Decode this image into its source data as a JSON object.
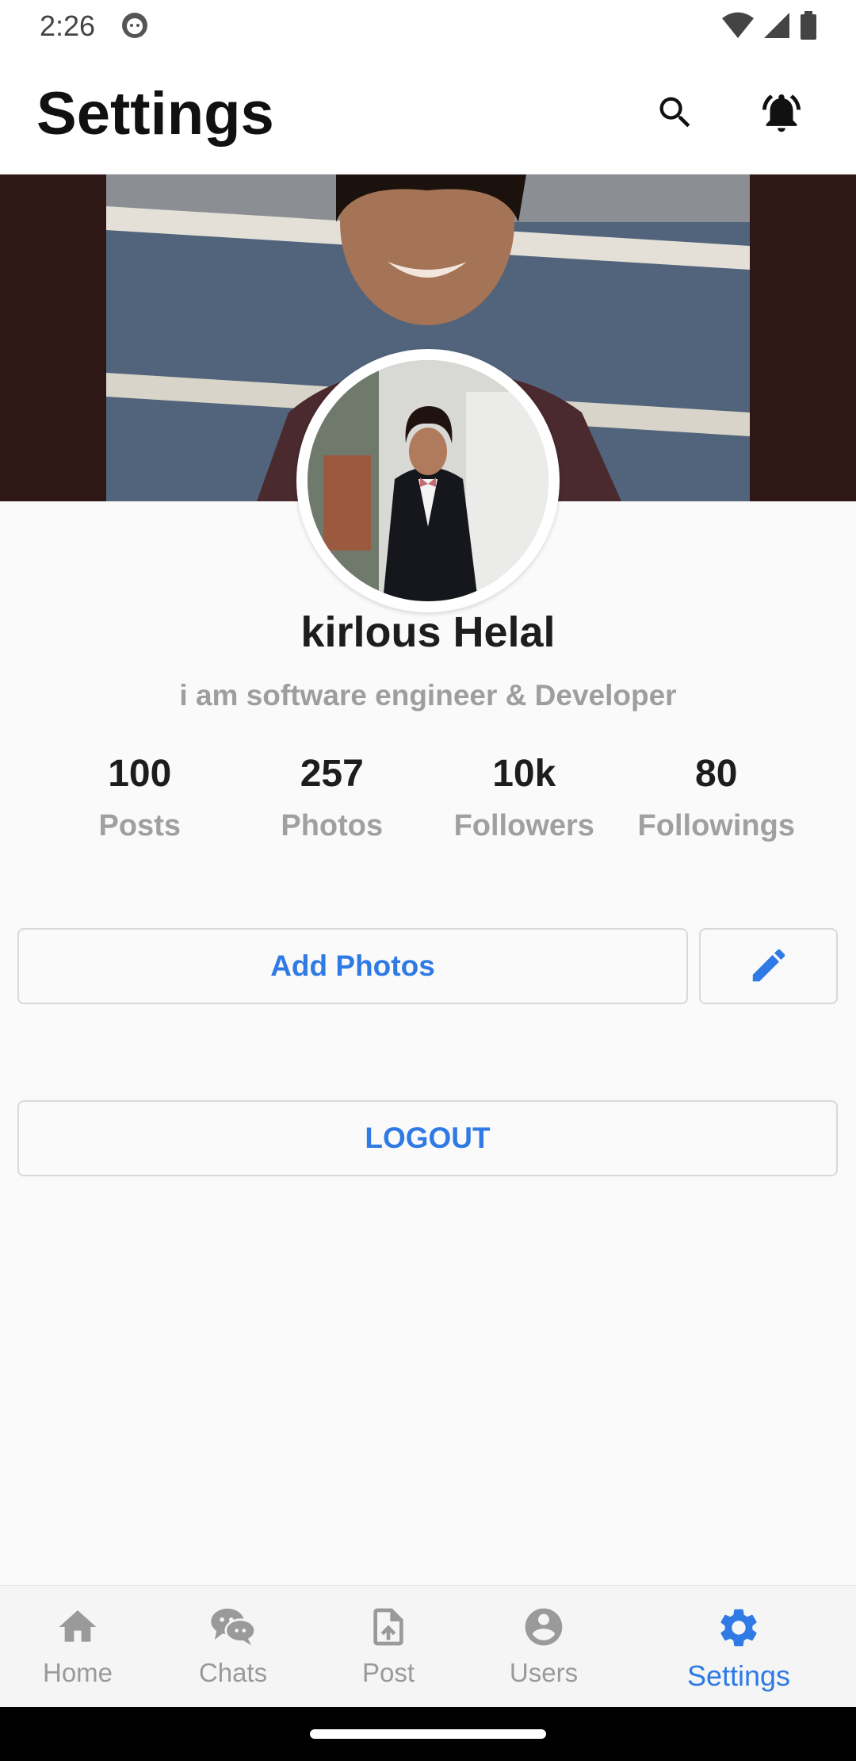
{
  "status_bar": {
    "time": "2:26",
    "icons": [
      "app-notification-icon",
      "wifi-icon",
      "signal-icon",
      "battery-icon"
    ]
  },
  "app_bar": {
    "title": "Settings",
    "actions": [
      "search-icon",
      "notifications-icon"
    ]
  },
  "profile": {
    "name": "kirlous Helal",
    "bio": "i am software engineer & Developer",
    "stats": [
      {
        "value": "100",
        "label": "Posts"
      },
      {
        "value": "257",
        "label": "Photos"
      },
      {
        "value": "10k",
        "label": "Followers"
      },
      {
        "value": "80",
        "label": "Followings"
      }
    ]
  },
  "actions": {
    "add_photos_label": "Add Photos",
    "edit_icon": "edit-icon",
    "logout_label": "LOGOUT"
  },
  "bottom_nav": {
    "items": [
      {
        "label": "Home",
        "icon": "home-icon",
        "active": false
      },
      {
        "label": "Chats",
        "icon": "chats-icon",
        "active": false
      },
      {
        "label": "Post",
        "icon": "post-icon",
        "active": false
      },
      {
        "label": "Users",
        "icon": "users-icon",
        "active": false
      },
      {
        "label": "Settings",
        "icon": "settings-icon",
        "active": true
      }
    ]
  },
  "colors": {
    "accent": "#2f7ae5",
    "inactive": "#9a9a9a",
    "background": "#fafafa",
    "cover_side": "#2e1715"
  }
}
